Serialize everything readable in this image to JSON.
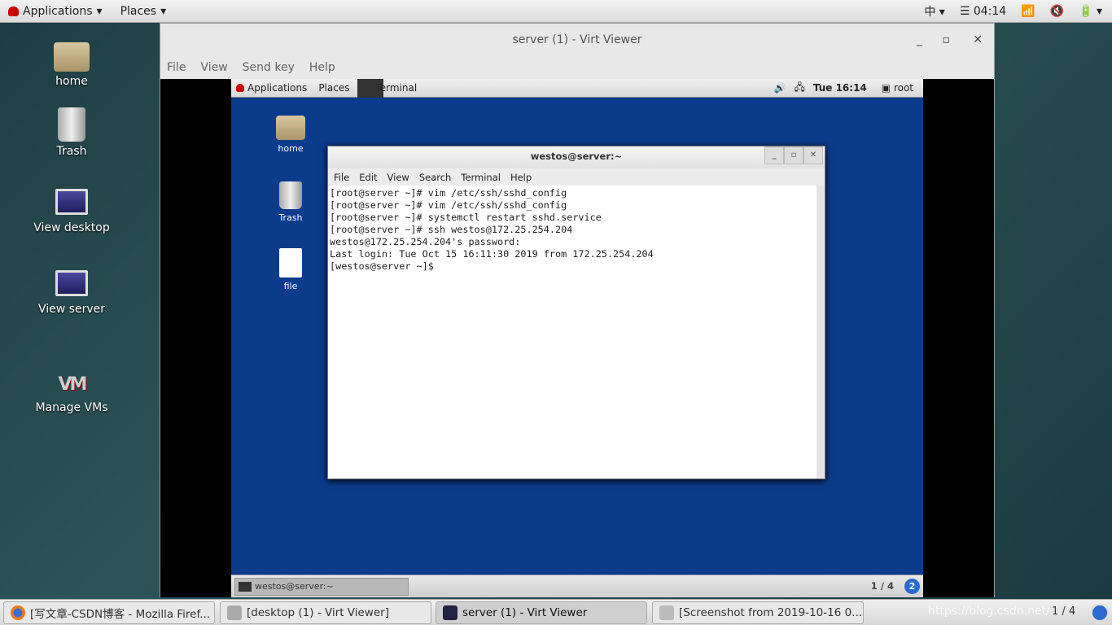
{
  "topbar": {
    "applications": "Applications",
    "places": "Places",
    "input_method": "中",
    "clock": "04:14",
    "icons": [
      "wifi-icon",
      "volume-muted-icon",
      "battery-icon"
    ]
  },
  "desktop": {
    "icons": [
      "home",
      "Trash",
      "View desktop",
      "View server",
      "Manage VMs"
    ]
  },
  "viewer": {
    "title": "server (1) - Virt Viewer",
    "menu": [
      "File",
      "View",
      "Send key",
      "Help"
    ]
  },
  "guest": {
    "topbar": {
      "applications": "Applications",
      "places": "Places",
      "task": "Terminal",
      "clock": "Tue 16:14",
      "user": "root"
    },
    "icons": [
      "home",
      "Trash",
      "file"
    ],
    "bottombar": {
      "task": "westos@server:~",
      "workspace": "1 / 4"
    },
    "terminal": {
      "title": "westos@server:~",
      "menu": [
        "File",
        "Edit",
        "View",
        "Search",
        "Terminal",
        "Help"
      ],
      "lines": [
        "[root@server ~]# vim /etc/ssh/sshd_config",
        "[root@server ~]# vim /etc/ssh/sshd_config",
        "[root@server ~]# systemctl restart sshd.service",
        "[root@server ~]# ssh westos@172.25.254.204",
        "westos@172.25.254.204's password: ",
        "Last login: Tue Oct 15 16:11:30 2019 from 172.25.254.204",
        "[westos@server ~]$ "
      ]
    }
  },
  "taskbar": {
    "tasks": [
      "[写文章-CSDN博客 - Mozilla Firef...",
      "[desktop (1) - Virt Viewer]",
      "server (1) - Virt Viewer",
      "[Screenshot from 2019-10-16 0..."
    ],
    "workspace": "1 / 4",
    "watermark": "https://blog.csdn.net/..."
  }
}
